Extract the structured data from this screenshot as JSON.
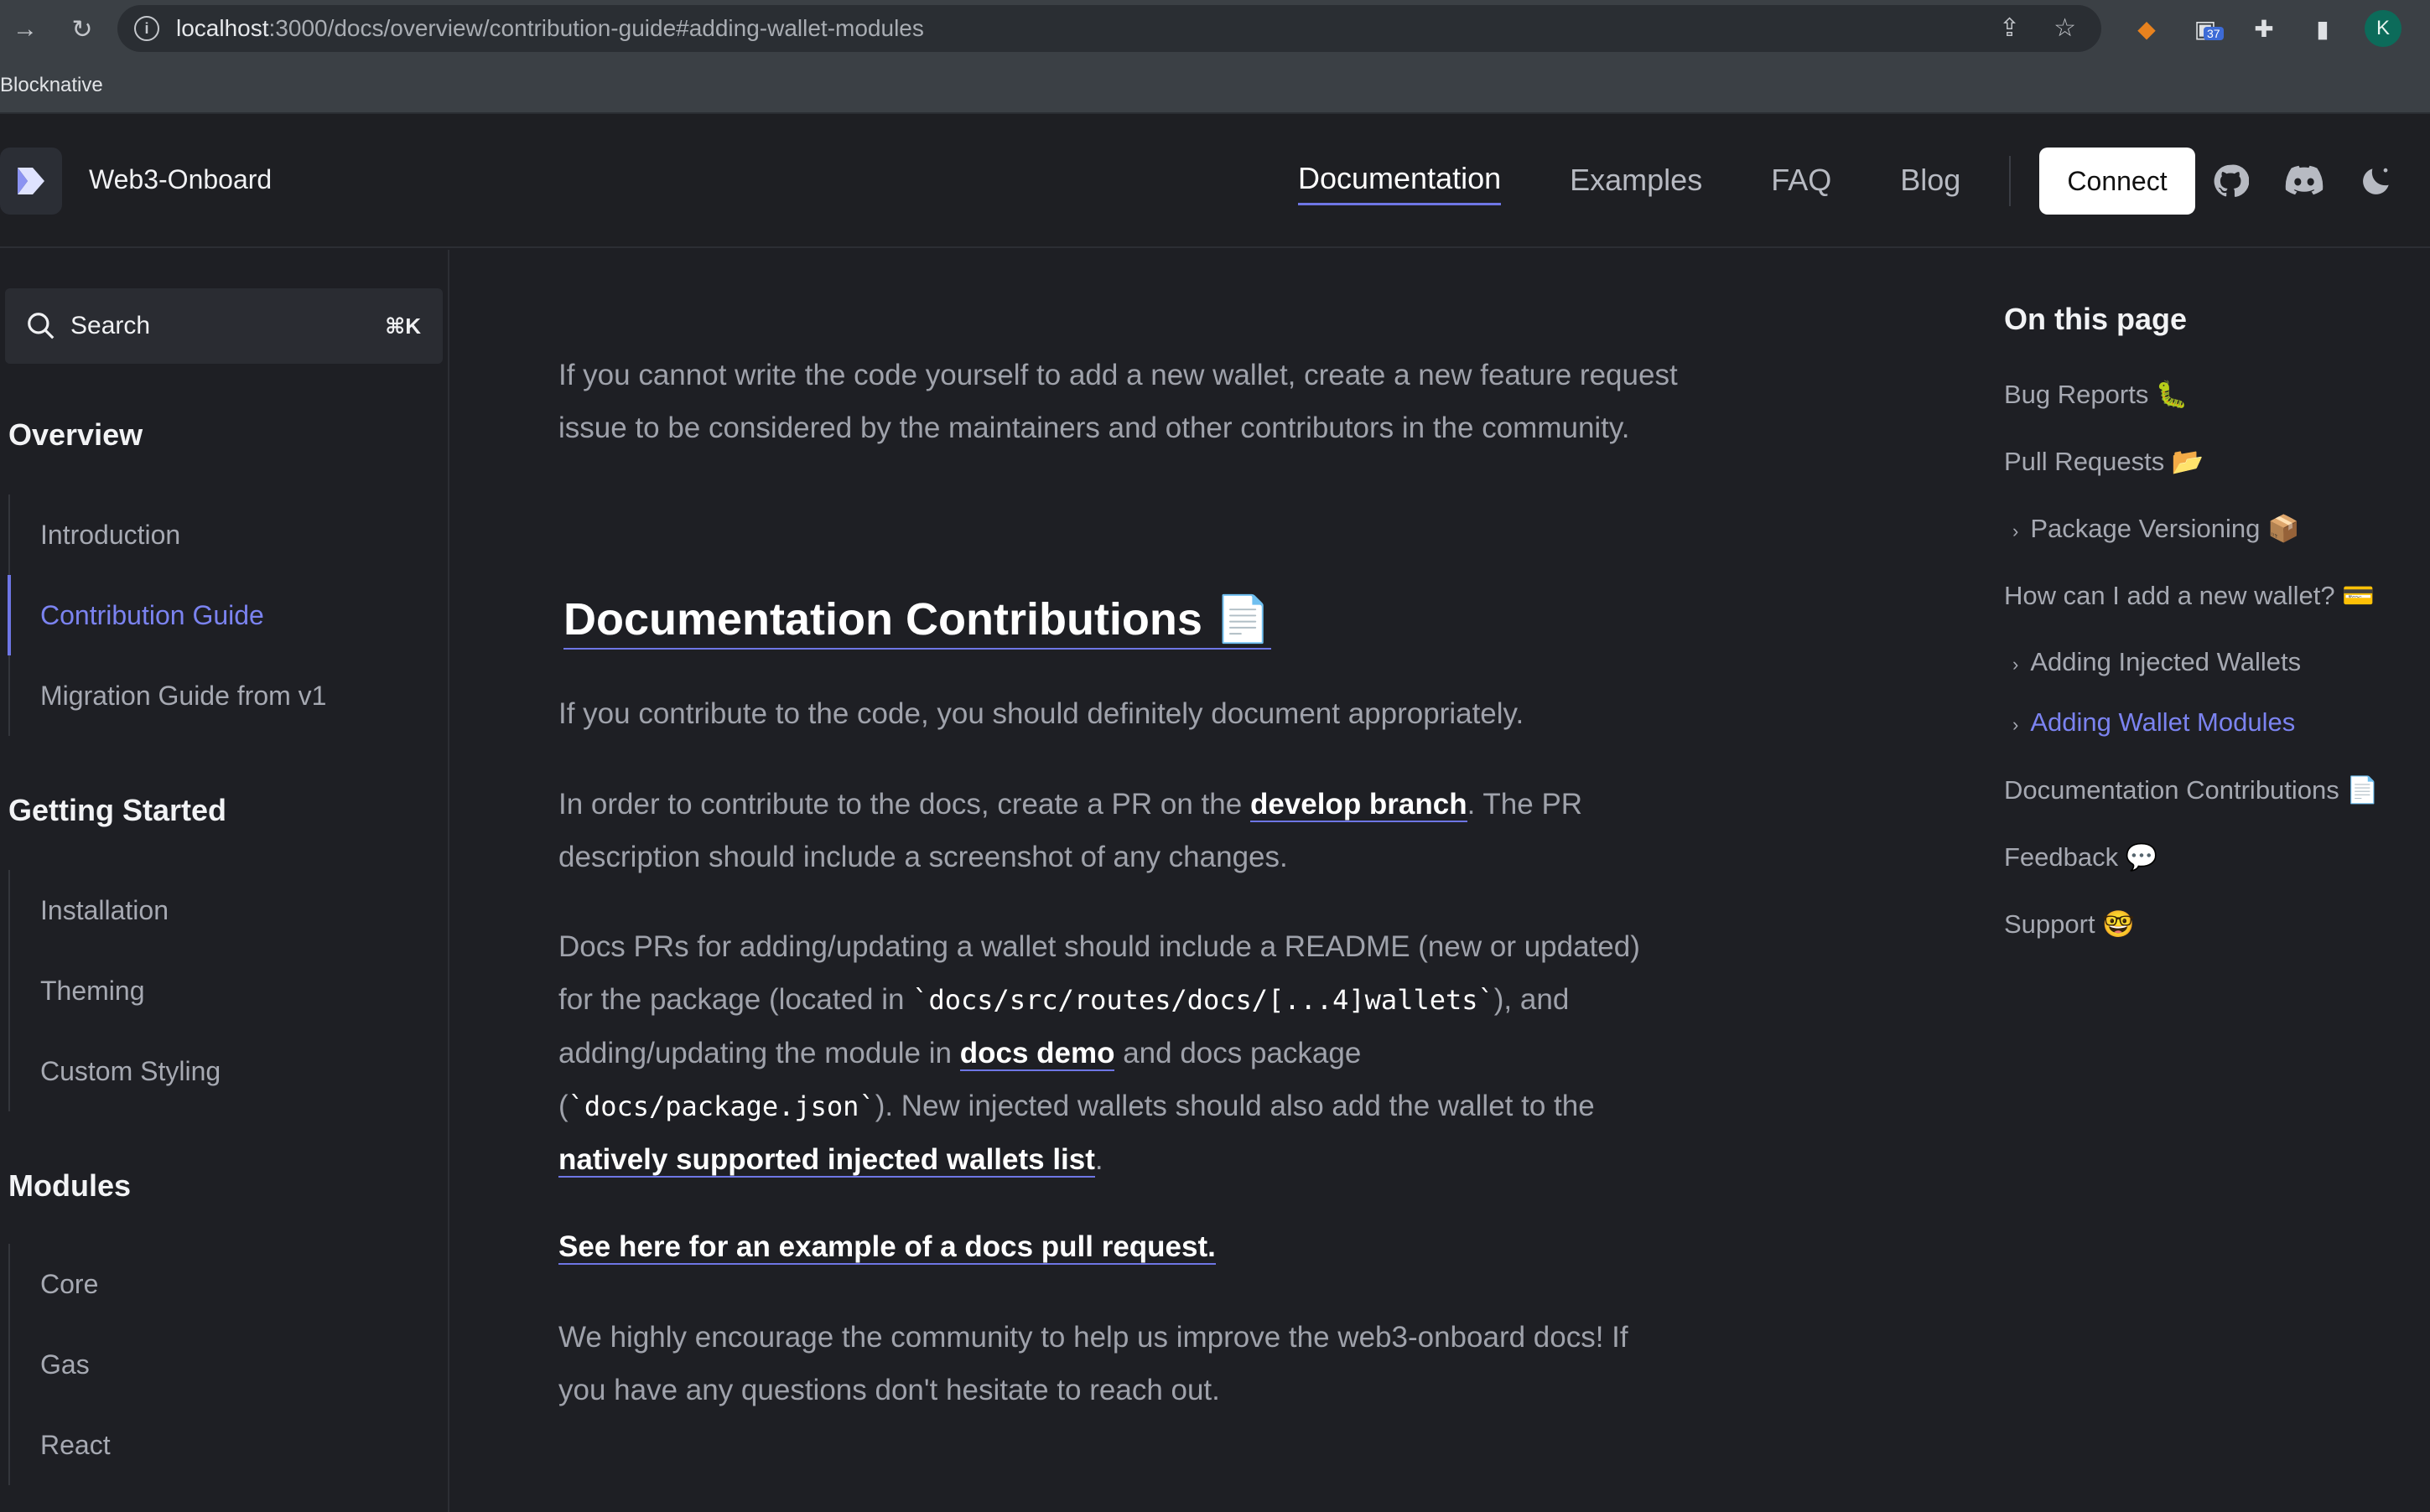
{
  "browser": {
    "url_host": "localhost",
    "url_path": ":3000/docs/overview/contribution-guide#adding-wallet-modules",
    "bookmark": "Blocknative",
    "extension_badge": "37",
    "profile_initial": "K"
  },
  "header": {
    "brand": "Web3-Onboard",
    "nav": [
      "Documentation",
      "Examples",
      "FAQ",
      "Blog"
    ],
    "connect_label": "Connect"
  },
  "sidebar": {
    "search_label": "Search",
    "search_shortcut": "⌘K",
    "sections": [
      {
        "title": "Overview",
        "items": [
          "Introduction",
          "Contribution Guide",
          "Migration Guide from v1"
        ]
      },
      {
        "title": "Getting Started",
        "items": [
          "Installation",
          "Theming",
          "Custom Styling"
        ]
      },
      {
        "title": "Modules",
        "items": [
          "Core",
          "Gas",
          "React"
        ]
      }
    ]
  },
  "content": {
    "p1": "If you cannot write the code yourself to add a new wallet, create a new feature request issue to be considered by the maintainers and other contributors in the community.",
    "h2": "Documentation Contributions 📄",
    "p2": "If you contribute to the code, you should definitely document appropriately.",
    "p3_pre": "In order to contribute to the docs, create a PR on the ",
    "p3_link": "develop branch",
    "p3_post": ". The PR description should include a screenshot of any changes.",
    "p4_a": "Docs PRs for adding/updating a wallet should include a README (new or updated) for the package (located in ",
    "p4_code1": "`docs/src/routes/docs/[...4]wallets`",
    "p4_b": "), and adding/updating the module in ",
    "p4_link1": "docs demo",
    "p4_c": " and docs package (",
    "p4_code2": "`docs/package.json`",
    "p4_d": "). New injected wallets should also add the wallet to the ",
    "p4_link2": "natively supported injected wallets list",
    "p4_e": ".",
    "p5_link": "See here for an example of a docs pull request.",
    "p6": "We highly encourage the community to help us improve the web3-onboard docs! If you have any questions don't hesitate to reach out."
  },
  "toc": {
    "title": "On this page",
    "items": [
      "Bug Reports 🐛",
      "Pull Requests 📂",
      "Package Versioning 📦",
      "How can I add a new wallet? 💳",
      "Adding Injected Wallets",
      "Adding Wallet Modules",
      "Documentation Contributions 📄",
      "Feedback 💬",
      "Support 🤓"
    ]
  }
}
